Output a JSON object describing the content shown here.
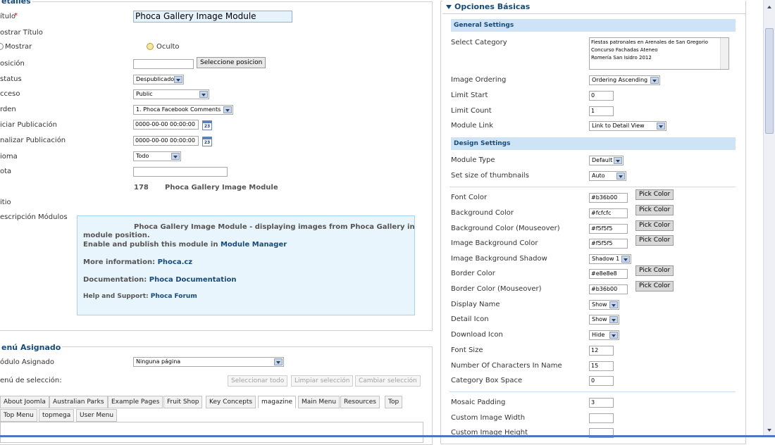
{
  "details": {
    "legend": "etalles",
    "fields": {
      "titulo_label": "ítulo",
      "titulo_required": "*",
      "titulo_value": "Phoca Gallery Image Module",
      "mostrar_titulo_label": "ostrar Título",
      "mostrar_option": "Mostrar",
      "oculto_option": "Oculto",
      "posicion_label": "osición",
      "posicion_button": "Seleccione posicion",
      "status_label": "status",
      "status_value": "Despublicado",
      "acceso_label": "cceso",
      "acceso_value": "Public",
      "orden_label": "rden",
      "orden_value": "1. Phoca Facebook Comments",
      "iniciar_label": "iciar Publicación",
      "iniciar_value": "0000-00-00 00:00:00",
      "finalizar_label": "nalizar Publicación",
      "finalizar_value": "0000-00-00 00:00:00",
      "calendar_text": "23",
      "idioma_label": "ioma",
      "idioma_value": "Todo",
      "nota_label": "ota",
      "id_label": "",
      "id_value": "178",
      "module_name": "Phoca Gallery Image Module",
      "sitio_label": "itio",
      "descripcion_label": "escripción Módulos"
    },
    "info": {
      "line1": "Phoca Gallery Image Module - displaying images from Phoca Gallery in",
      "line2": "module position.",
      "line3_prefix": "Enable and publish this module in",
      "line3_link": "Module Manager",
      "line4_prefix": "More information:",
      "line4_link": "Phoca.cz",
      "line5_prefix": "Documentation:",
      "line5_link": "Phoca Documentation",
      "line6_prefix": "Help and Support:",
      "line6_link": "Phoca Forum"
    }
  },
  "menu": {
    "legend": "enú Asignado",
    "modulo_label": "ódulo Asignado",
    "modulo_value": "Ninguna página",
    "seleccion_label": "enú de selección:",
    "buttons": [
      "Seleccionar todo",
      "Limpiar selección",
      "Cambiar selección"
    ],
    "tabs_row1": [
      "About Joomla",
      "Australian Parks",
      "Example Pages",
      "Fruit Shop",
      "Key Concepts",
      "magazine",
      "Main Menu",
      "Resources",
      "Top"
    ],
    "tabs_row2": [
      "Top Menu",
      "topmega",
      "User Menu"
    ],
    "active_tab": "magazine"
  },
  "options": {
    "header": "Opciones Básicas",
    "general_settings": "General Settings",
    "select_category_label": "Select Category",
    "categories": [
      "Fiestas patronales en Arenales de San Gregorio",
      "Concurso Fachadas Ateneo",
      "Romería San Isidro 2012"
    ],
    "image_ordering_label": "Image Ordering",
    "image_ordering_value": "Ordering Ascending",
    "limit_start_label": "Limit Start",
    "limit_start_value": "0",
    "limit_count_label": "Limit Count",
    "limit_count_value": "1",
    "module_link_label": "Module Link",
    "module_link_value": "Link to Detail View",
    "design_settings": "Design Settings",
    "module_type_label": "Module Type",
    "module_type_value": "Default",
    "thumb_size_label": "Set size of thumbnails",
    "thumb_size_value": "Auto",
    "pick_color": "Pick Color",
    "font_color_label": "Font Color",
    "font_color_value": "#b36b00",
    "bg_color_label": "Background Color",
    "bg_color_value": "#fcfcfc",
    "bg_mouse_label": "Background Color (Mouseover)",
    "bg_mouse_value": "#f5f5f5",
    "img_bg_label": "Image Background Color",
    "img_bg_value": "#f5f5f5",
    "img_shadow_label": "Image Background Shadow",
    "img_shadow_value": "Shadow 1",
    "border_color_label": "Border Color",
    "border_color_value": "#e8e8e8",
    "border_mouse_label": "Border Color (Mouseover)",
    "border_mouse_value": "#b36b00",
    "display_name_label": "Display Name",
    "display_name_value": "Show",
    "detail_icon_label": "Detail Icon",
    "detail_icon_value": "Show",
    "download_icon_label": "Download Icon",
    "download_icon_value": "Hide",
    "font_size_label": "Font Size",
    "font_size_value": "12",
    "num_chars_label": "Number Of Characters In Name",
    "num_chars_value": "15",
    "cat_box_label": "Category Box Space",
    "cat_box_value": "0",
    "mosaic_label": "Mosaic Padding",
    "mosaic_value": "3",
    "custom_width_label": "Custom Image Width",
    "custom_width_value": "",
    "custom_height_label": "Custom Image Height"
  },
  "colors": {
    "accent": "#164a7a",
    "section_bg": "#cfe3f6",
    "info_bg": "#e9f5fc"
  }
}
